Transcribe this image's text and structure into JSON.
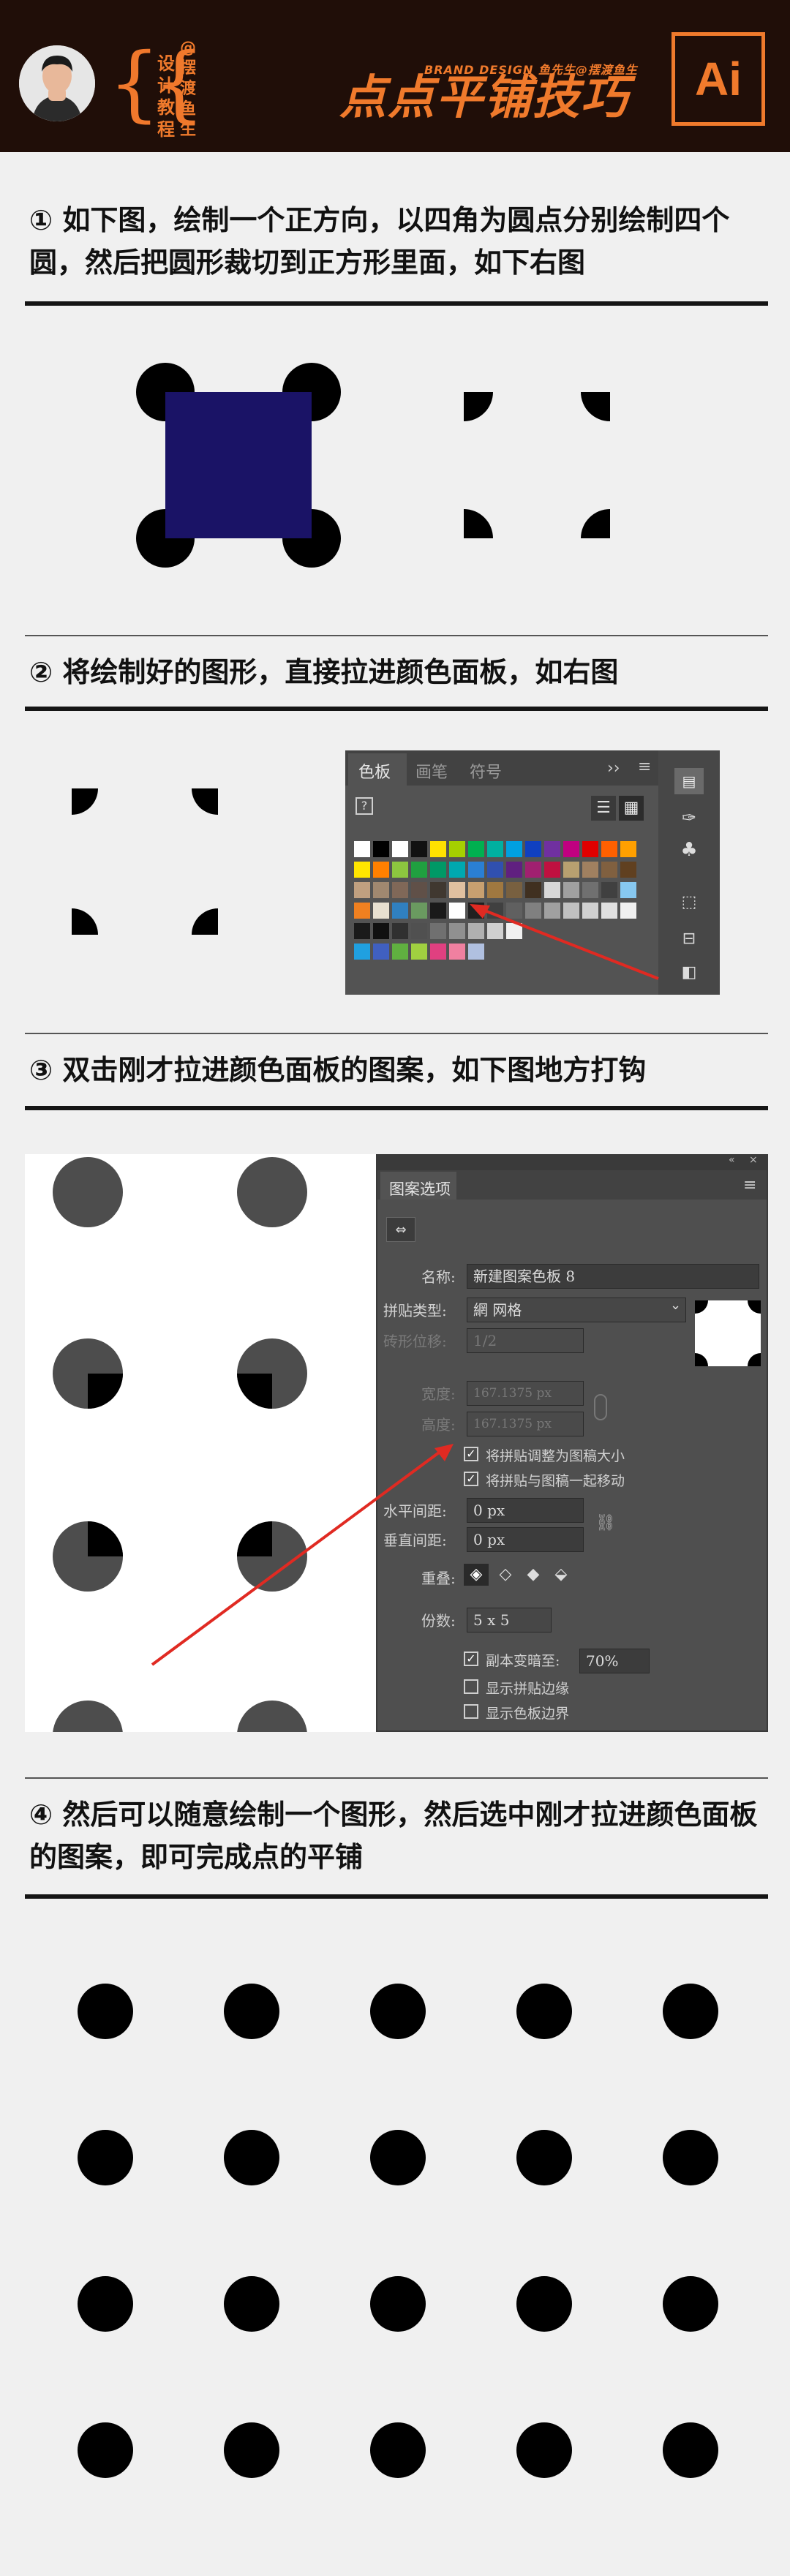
{
  "header": {
    "brand_line": "BRAND DESIGN 鱼先生@摆渡鱼生",
    "title": "点点平铺技巧",
    "logo_text": "Ai",
    "vertical_left": "设计教程",
    "vertical_right": "@摆渡鱼生",
    "colors": {
      "background": "#200e08",
      "accent": "#f07a2c"
    }
  },
  "steps": [
    {
      "text": "① 如下图，绘制一个正方向，以四角为圆点分别绘制四个圆，然后把圆形裁切到正方形里面，如下右图"
    },
    {
      "text": "② 将绘制好的图形，直接拉进颜色面板，如右图"
    },
    {
      "text": "③ 双击刚才拉进颜色面板的图案，如下图地方打钩"
    },
    {
      "text": "④ 然后可以随意绘制一个图形，然后选中刚才拉进颜色面板的图案，即可完成点的平铺"
    }
  ],
  "swatch_panel": {
    "tabs": [
      "色板",
      "画笔",
      "符号"
    ],
    "menu_glyph": "≡",
    "expand_glyph": "››",
    "none_swatch": "?"
  },
  "pattern_panel": {
    "title": "图案选项",
    "name_label": "名称:",
    "name_value": "新建图案色板 8",
    "tile_type_label": "拼贴类型:",
    "tile_type_value": "網 网格",
    "offset_label": "砖形位移:",
    "offset_value": "1/2",
    "width_label": "宽度:",
    "width_value": "167.1375 px",
    "height_label": "高度:",
    "height_value": "167.1375 px",
    "check_resize": "将拼贴调整为图稿大小",
    "check_move": "将拼贴与图稿一起移动",
    "h_spacing_label": "水平间距:",
    "h_spacing_value": "0 px",
    "v_spacing_label": "垂直间距:",
    "v_spacing_value": "0 px",
    "overlap_label": "重叠:",
    "copies_label": "份数:",
    "copies_value": "5 x 5",
    "dim_label": "副本变暗至:",
    "dim_value": "70%",
    "show_edge": "显示拼贴边缘",
    "show_bounds": "显示色板边界",
    "checked_resize": true,
    "checked_move": true,
    "checked_dim": true,
    "checked_edge": false,
    "checked_bounds": false
  },
  "colors": {
    "square": "#1a1366",
    "panel": "#4f4f4f",
    "arrow": "#e02a22"
  }
}
